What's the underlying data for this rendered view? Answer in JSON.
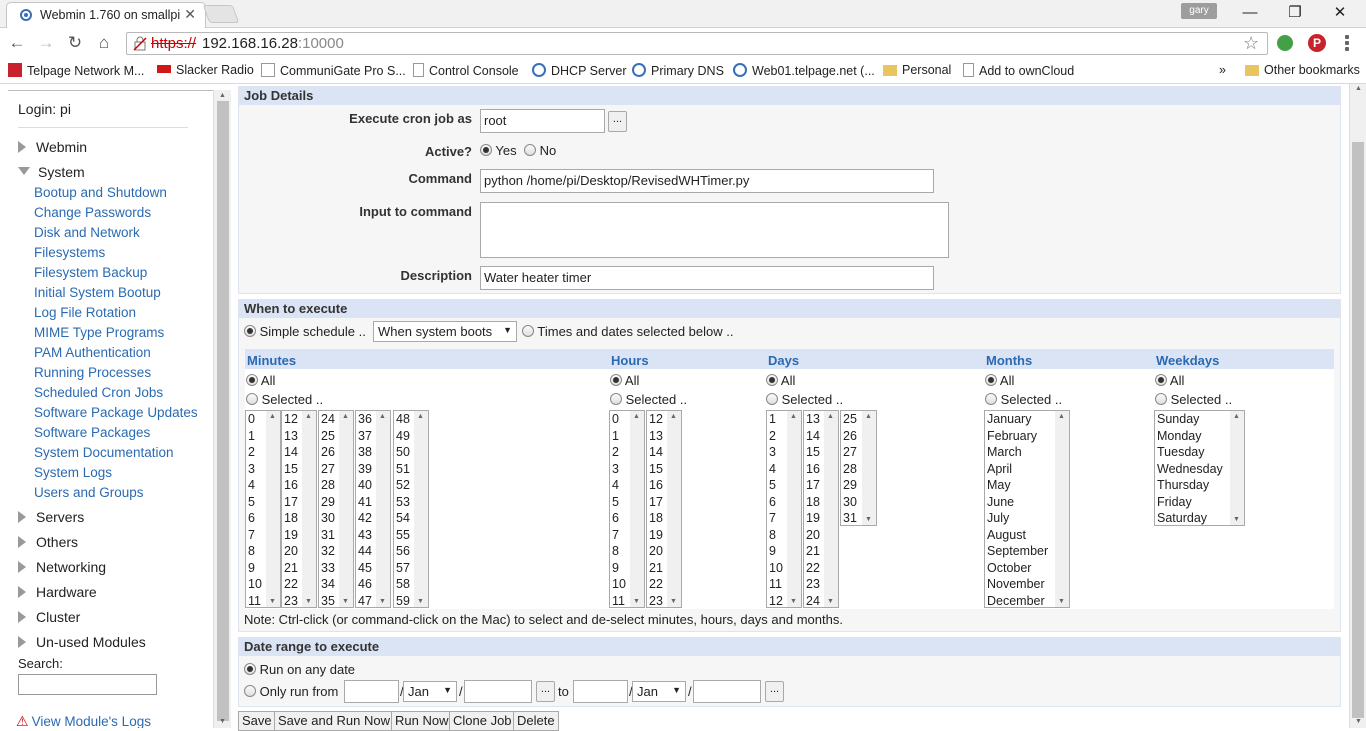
{
  "browser": {
    "tab_title": "Webmin 1.760 on smallpi",
    "user": "gary",
    "url_scheme": "https://",
    "url_host": "192.168.16.28",
    "url_port": ":10000",
    "bookmarks": [
      "Telpage Network M...",
      "Slacker Radio",
      "CommuniGate Pro S...",
      "Control Console",
      "DHCP Server",
      "Primary DNS",
      "Web01.telpage.net (...",
      "Personal",
      "Add to ownCloud"
    ],
    "more_bookmarks": "»",
    "other_bookmarks": "Other bookmarks"
  },
  "sidebar": {
    "login": "Login: pi",
    "categories": {
      "webmin": "Webmin",
      "system": "System",
      "servers": "Servers",
      "others": "Others",
      "networking": "Networking",
      "hardware": "Hardware",
      "cluster": "Cluster",
      "unused": "Un-used Modules"
    },
    "system_modules": [
      "Bootup and Shutdown",
      "Change Passwords",
      "Disk and Network",
      "Filesystems",
      "Filesystem Backup",
      "Initial System Bootup",
      "Log File Rotation",
      "MIME Type Programs",
      "PAM Authentication",
      "Running Processes",
      "Scheduled Cron Jobs",
      "Software Package Updates",
      "Software Packages",
      "System Documentation",
      "System Logs",
      "Users and Groups"
    ],
    "search_label": "Search:",
    "view_logs": "View Module's Logs"
  },
  "job": {
    "section_title": "Job Details",
    "run_as_label": "Execute cron job as",
    "run_as_value": "root",
    "browse": "...",
    "active_label": "Active?",
    "yes": "Yes",
    "no": "No",
    "command_label": "Command",
    "command_value": "python /home/pi/Desktop/RevisedWHTimer.py",
    "input_label": "Input to command",
    "description_label": "Description",
    "description_value": "Water heater timer"
  },
  "when": {
    "section_title": "When to execute",
    "simple_label": "Simple schedule ..",
    "simple_value": "When system boots",
    "times_label": "Times and dates selected below ..",
    "all": "All",
    "selected": "Selected ..",
    "minutes_title": "Minutes",
    "hours_title": "Hours",
    "days_title": "Days",
    "months_title": "Months",
    "weekdays_title": "Weekdays",
    "minutes_cols": [
      [
        "0",
        "1",
        "2",
        "3",
        "4",
        "5",
        "6",
        "7",
        "8",
        "9",
        "10",
        "11"
      ],
      [
        "12",
        "13",
        "14",
        "15",
        "16",
        "17",
        "18",
        "19",
        "20",
        "21",
        "22",
        "23"
      ],
      [
        "24",
        "25",
        "26",
        "27",
        "28",
        "29",
        "30",
        "31",
        "32",
        "33",
        "34",
        "35"
      ],
      [
        "36",
        "37",
        "38",
        "39",
        "40",
        "41",
        "42",
        "43",
        "44",
        "45",
        "46",
        "47"
      ],
      [
        "48",
        "49",
        "50",
        "51",
        "52",
        "53",
        "54",
        "55",
        "56",
        "57",
        "58",
        "59"
      ]
    ],
    "hours_cols": [
      [
        "0",
        "1",
        "2",
        "3",
        "4",
        "5",
        "6",
        "7",
        "8",
        "9",
        "10",
        "11"
      ],
      [
        "12",
        "13",
        "14",
        "15",
        "16",
        "17",
        "18",
        "19",
        "20",
        "21",
        "22",
        "23"
      ]
    ],
    "days_cols": [
      [
        "1",
        "2",
        "3",
        "4",
        "5",
        "6",
        "7",
        "8",
        "9",
        "10",
        "11",
        "12"
      ],
      [
        "13",
        "14",
        "15",
        "16",
        "17",
        "18",
        "19",
        "20",
        "21",
        "22",
        "23",
        "24"
      ],
      [
        "25",
        "26",
        "27",
        "28",
        "29",
        "30",
        "31"
      ]
    ],
    "months": [
      "January",
      "February",
      "March",
      "April",
      "May",
      "June",
      "July",
      "August",
      "September",
      "October",
      "November",
      "December"
    ],
    "weekdays": [
      "Sunday",
      "Monday",
      "Tuesday",
      "Wednesday",
      "Thursday",
      "Friday",
      "Saturday"
    ],
    "note": "Note: Ctrl-click (or command-click on the Mac) to select and de-select minutes, hours, days and months."
  },
  "range": {
    "section_title": "Date range to execute",
    "any_date": "Run on any date",
    "only_from": "Only run from",
    "from_month": "Jan",
    "to": "to",
    "to_month": "Jan",
    "slash": "/",
    "browse": "..."
  },
  "buttons": {
    "save": "Save",
    "save_run": "Save and Run Now",
    "run_now": "Run Now",
    "clone": "Clone Job",
    "delete": "Delete"
  },
  "colors": {
    "section_header": "#dbe4f5",
    "link": "#2a6ab2"
  }
}
